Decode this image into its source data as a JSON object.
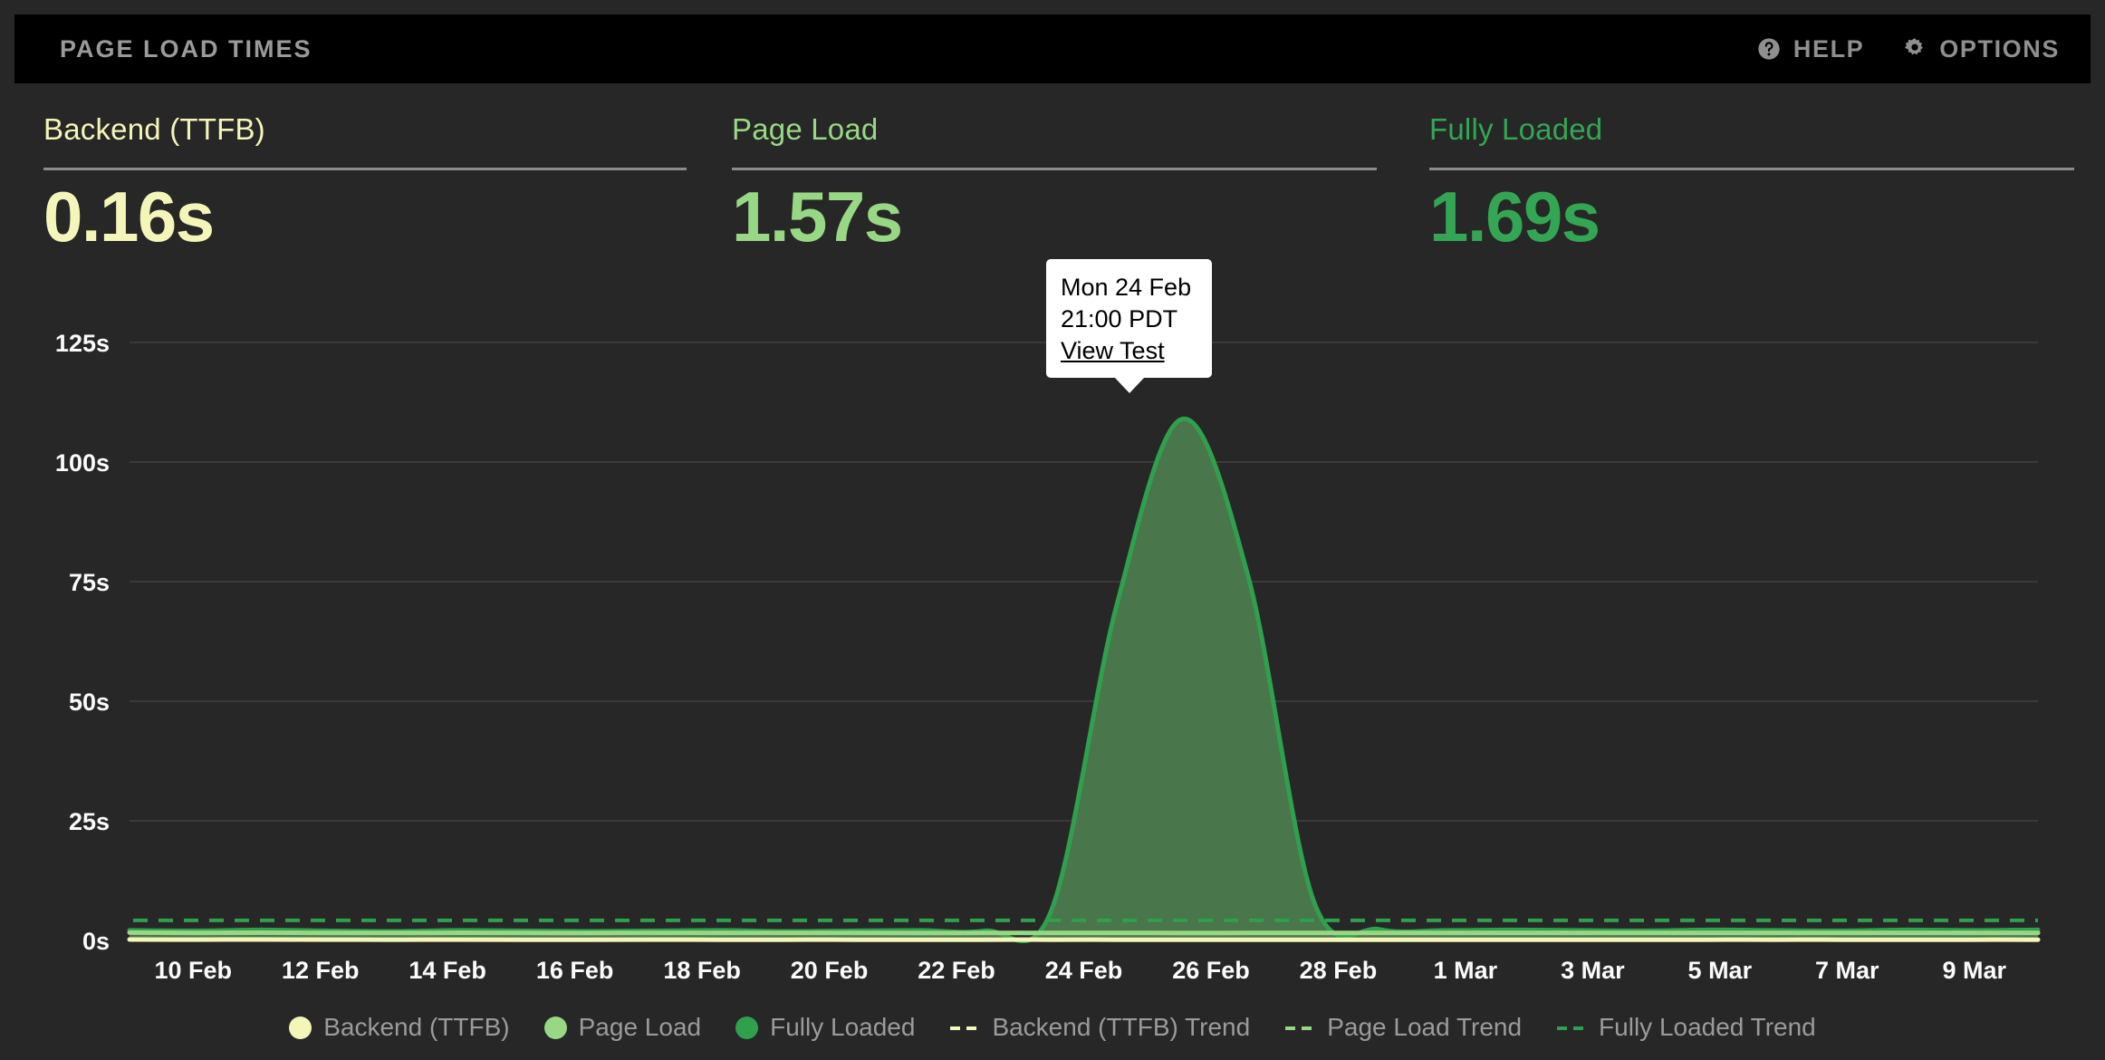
{
  "header": {
    "title": "PAGE LOAD TIMES",
    "actions": [
      {
        "label": "HELP",
        "icon": "help-circle-icon"
      },
      {
        "label": "OPTIONS",
        "icon": "gear-icon"
      }
    ]
  },
  "cards": [
    {
      "label": "Backend (TTFB)",
      "value": "0.16s",
      "color": "#f4f5b8"
    },
    {
      "label": "Page Load",
      "value": "1.57s",
      "color": "#98d884"
    },
    {
      "label": "Fully Loaded",
      "value": "1.69s",
      "color": "#33a653"
    }
  ],
  "tooltip": {
    "date": "Mon 24 Feb",
    "time": "21:00 PDT",
    "link": "View Test"
  },
  "legend": [
    {
      "label": "Backend (TTFB)",
      "style": "dot",
      "color": "#f4f5b8"
    },
    {
      "label": "Page Load",
      "style": "dot",
      "color": "#98d884"
    },
    {
      "label": "Fully Loaded",
      "style": "dot",
      "color": "#2fa04e"
    },
    {
      "label": "Backend (TTFB) Trend",
      "style": "dash",
      "color": "#f4f5b8"
    },
    {
      "label": "Page Load Trend",
      "style": "dash",
      "color": "#98d884"
    },
    {
      "label": "Fully Loaded Trend",
      "style": "dash",
      "color": "#2fa04e"
    }
  ],
  "chart_data": {
    "type": "area",
    "title": "Page Load Times",
    "xlabel": "",
    "ylabel": "",
    "ylim": [
      0,
      137
    ],
    "grid": true,
    "legend_position": "bottom",
    "y_ticks": [
      "0s",
      "25s",
      "50s",
      "75s",
      "100s",
      "125s"
    ],
    "y_tick_values": [
      0,
      25,
      50,
      75,
      100,
      125
    ],
    "x_ticks": [
      "10 Feb",
      "12 Feb",
      "14 Feb",
      "16 Feb",
      "18 Feb",
      "20 Feb",
      "22 Feb",
      "24 Feb",
      "26 Feb",
      "28 Feb",
      "1 Mar",
      "3 Mar",
      "5 Mar",
      "7 Mar",
      "9 Mar"
    ],
    "annotations": [
      {
        "x": "24 Feb",
        "time": "21:00 PDT",
        "label": "Mon 24 Feb 21:00 PDT",
        "link": "View Test"
      }
    ],
    "series": [
      {
        "name": "Backend (TTFB)",
        "color": "#f4f5b8",
        "values": [
          0.18,
          0.17,
          0.18,
          0.17,
          0.16,
          0.17,
          0.16,
          0.16,
          0.17,
          0.16,
          0.16,
          0.16,
          0.15,
          0.16,
          0.16,
          0.16,
          0.15,
          0.16,
          0.16,
          0.15,
          0.16,
          0.16,
          0.16,
          0.15,
          0.16,
          0.16,
          0.16,
          0.15,
          0.16,
          0.16
        ]
      },
      {
        "name": "Page Load",
        "color": "#98d884",
        "values": [
          1.62,
          1.58,
          1.61,
          1.57,
          1.55,
          1.59,
          1.56,
          1.54,
          1.58,
          1.56,
          1.55,
          1.57,
          1.54,
          1.56,
          1.55,
          1.57,
          1.54,
          1.56,
          1.57,
          1.55,
          1.56,
          1.58,
          1.56,
          1.55,
          1.57,
          1.56,
          1.55,
          1.57,
          1.56,
          1.57
        ]
      },
      {
        "name": "Fully Loaded",
        "color": "#2fa04e",
        "fill": "#4c7b4e",
        "values": [
          2.1,
          2.0,
          2.2,
          2.0,
          1.9,
          2.1,
          2.0,
          1.9,
          2.0,
          2.1,
          1.9,
          2.0,
          2.1,
          2.0,
          6.0,
          70.0,
          109.0,
          76.0,
          8.0,
          2.3,
          2.1,
          2.2,
          2.1,
          2.0,
          2.2,
          2.1,
          2.0,
          2.2,
          2.1,
          2.2
        ]
      }
    ],
    "trends": [
      {
        "name": "Backend (TTFB) Trend",
        "color": "#f4f5b8",
        "value": 0.16
      },
      {
        "name": "Page Load Trend",
        "color": "#98d884",
        "value": 1.6
      },
      {
        "name": "Fully Loaded Trend",
        "color": "#2fa04e",
        "value": 4.2
      }
    ]
  }
}
